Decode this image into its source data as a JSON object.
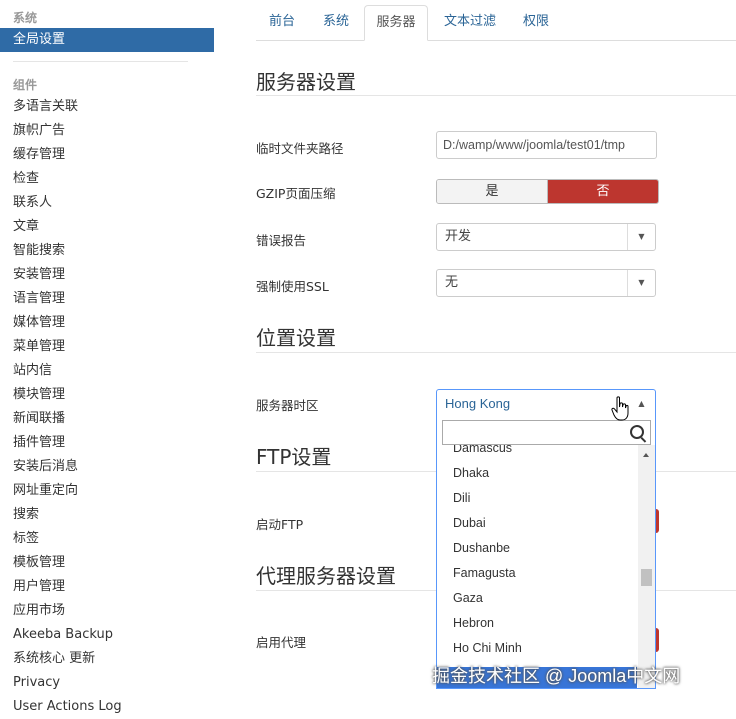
{
  "sidebar": {
    "system_header": "系统",
    "active_item": "全局设置",
    "components_header": "组件",
    "items": [
      "多语言关联",
      "旗帜广告",
      "缓存管理",
      "检查",
      "联系人",
      "文章",
      "智能搜索",
      "安装管理",
      "语言管理",
      "媒体管理",
      "菜单管理",
      "站内信",
      "模块管理",
      "新闻联播",
      "插件管理",
      "安装后消息",
      "网址重定向",
      "搜索",
      "标签",
      "模板管理",
      "用户管理",
      "应用市场",
      "Akeeba Backup",
      "系统核心 更新",
      "Privacy",
      "User Actions Log"
    ]
  },
  "tabs": [
    "前台",
    "系统",
    "服务器",
    "文本过滤",
    "权限"
  ],
  "active_tab": "服务器",
  "server": {
    "title": "服务器设置",
    "tmp_label": "临时文件夹路径",
    "tmp_value": "D:/wamp/www/joomla/test01/tmp",
    "gzip_label": "GZIP页面压缩",
    "gzip_yes": "是",
    "gzip_no": "否",
    "error_label": "错误报告",
    "error_value": "开发",
    "ssl_label": "强制使用SSL",
    "ssl_value": "无"
  },
  "location": {
    "title": "位置设置",
    "tz_label": "服务器时区",
    "tz_value": "Hong Kong",
    "tz_options": [
      "Damascus",
      "Dhaka",
      "Dili",
      "Dubai",
      "Dushanbe",
      "Famagusta",
      "Gaza",
      "Hebron",
      "Ho Chi Minh"
    ]
  },
  "ftp": {
    "title": "FTP设置",
    "enable_label": "启动FTP"
  },
  "proxy": {
    "title": "代理服务器设置",
    "enable_label": "启用代理"
  },
  "watermark": "掘金技术社区 @ Joomla中文网",
  "colors": {
    "active_bg": "#2f6ba6",
    "danger": "#bd362f",
    "link": "#2a6496",
    "highlight": "#3875d7"
  }
}
